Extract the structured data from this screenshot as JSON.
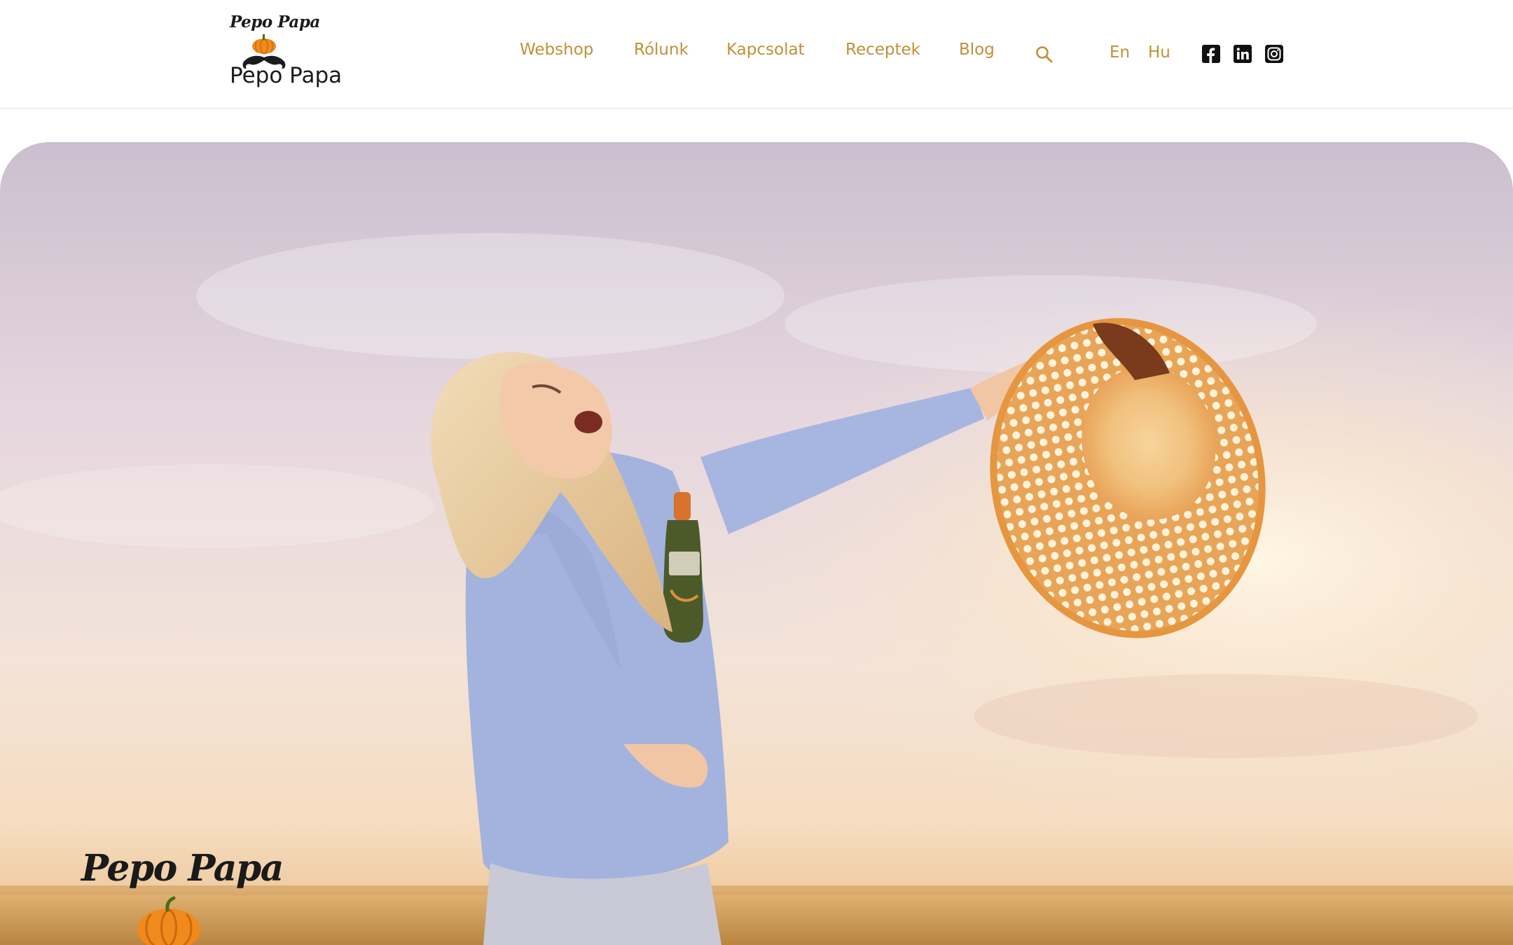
{
  "brand": {
    "script_name": "Pepo Papa",
    "name": "Pepo Papa",
    "logo_icon": "pumpkin-mustache-logo"
  },
  "nav": {
    "items": [
      {
        "label": "Webshop"
      },
      {
        "label": "Rólunk"
      },
      {
        "label": "Kapcsolat"
      },
      {
        "label": "Receptek"
      },
      {
        "label": "Blog"
      }
    ],
    "search_icon": "search-icon"
  },
  "languages": [
    {
      "label": "En"
    },
    {
      "label": "Hu"
    }
  ],
  "social": [
    {
      "icon": "facebook-icon"
    },
    {
      "icon": "linkedin-icon"
    },
    {
      "icon": "instagram-icon"
    }
  ],
  "hero": {
    "image": "woman-holding-oil-bottle-and-straw-hat-in-wheat-field",
    "logo_text": "Pepo Papa"
  },
  "colors": {
    "accent": "#c0903a",
    "text": "#1b1b1b",
    "pumpkin": "#f08a1c"
  }
}
